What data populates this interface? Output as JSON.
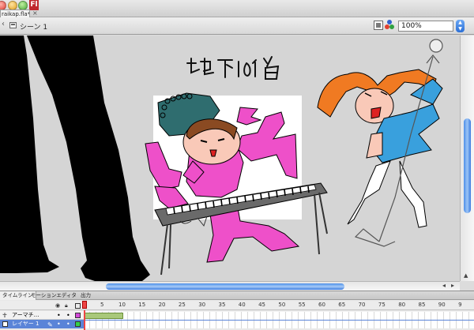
{
  "window": {
    "document_tab": "raikap.fla*",
    "app_badge": "Fl"
  },
  "editbar": {
    "scene_label": "シーン 1",
    "zoom_value": "100%"
  },
  "stage": {
    "handwritten_title": "地下101階"
  },
  "timeline": {
    "tabs": [
      "タイムライン",
      "モーションエディタ",
      "出力"
    ],
    "frame_numbers": [
      "1",
      "5",
      "10",
      "15",
      "20",
      "25",
      "30",
      "35",
      "40",
      "45",
      "50",
      "55",
      "60",
      "65",
      "70",
      "75",
      "80",
      "85",
      "90",
      "9"
    ],
    "layers": [
      {
        "name": "アーマチ…"
      },
      {
        "name": "レイヤー 1"
      }
    ]
  }
}
